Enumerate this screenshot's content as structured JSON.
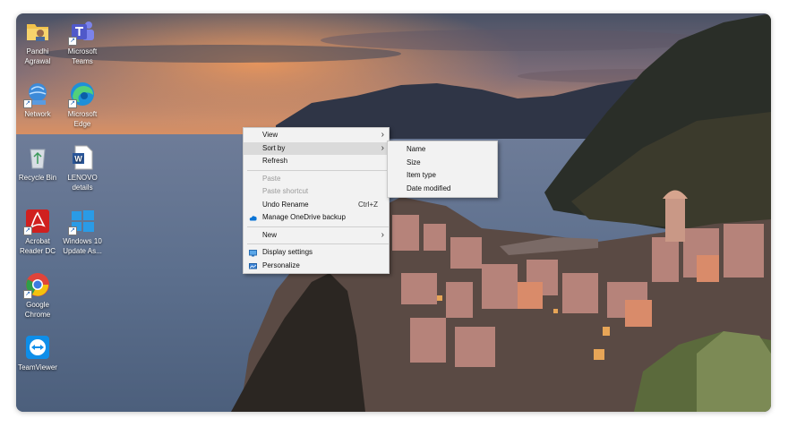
{
  "desktop_icons": [
    {
      "name": "folder-icon",
      "label": "Pandhi\nAgrawal"
    },
    {
      "name": "teams-icon",
      "label": "Microsoft\nTeams"
    },
    {
      "name": "network-icon",
      "label": "Network"
    },
    {
      "name": "edge-icon",
      "label": "Microsoft\nEdge"
    },
    {
      "name": "recycle-bin-icon",
      "label": "Recycle Bin"
    },
    {
      "name": "word-doc-icon",
      "label": "LENOVO\ndetails"
    },
    {
      "name": "acrobat-icon",
      "label": "Acrobat\nReader DC"
    },
    {
      "name": "windows-update-icon",
      "label": "Windows 10\nUpdate As..."
    },
    {
      "name": "chrome-icon",
      "label": "Google\nChrome"
    },
    {
      "name": "teamviewer-icon",
      "label": "TeamViewer"
    }
  ],
  "context_menu": {
    "view": "View",
    "sort_by": "Sort by",
    "refresh": "Refresh",
    "paste": "Paste",
    "paste_shortcut": "Paste shortcut",
    "undo_rename": "Undo Rename",
    "undo_rename_accel": "Ctrl+Z",
    "manage_onedrive": "Manage OneDrive backup",
    "new": "New",
    "display_settings": "Display settings",
    "personalize": "Personalize"
  },
  "submenu": {
    "name": "Name",
    "size": "Size",
    "item_type": "Item type",
    "date_modified": "Date modified"
  },
  "colors": {
    "menu_bg": "#f2f2f2",
    "highlight": "#dadada",
    "disabled_text": "#9a9a9a"
  }
}
